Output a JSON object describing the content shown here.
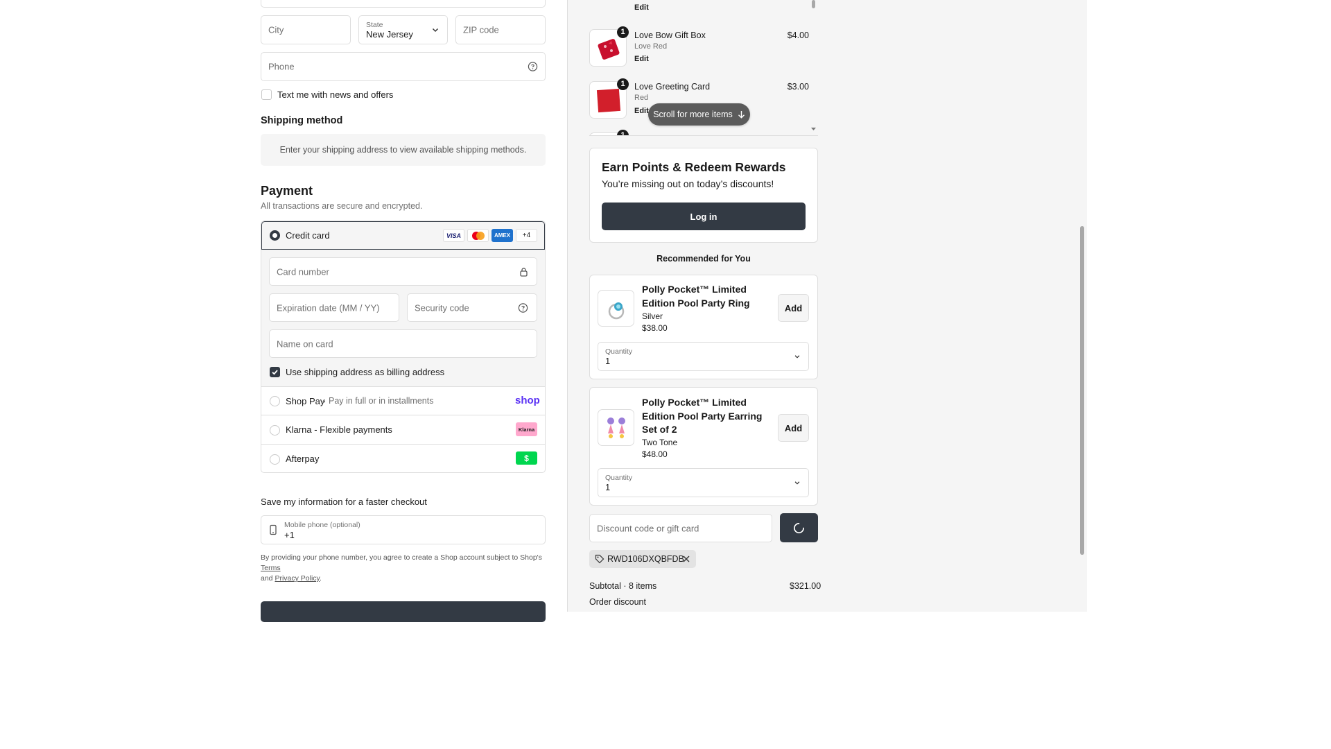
{
  "address": {
    "city_placeholder": "City",
    "state_label": "State",
    "state_value": "New Jersey",
    "zip_placeholder": "ZIP code",
    "phone_placeholder": "Phone",
    "text_offers_label": "Text me with news and offers"
  },
  "shipping": {
    "heading": "Shipping method",
    "notice": "Enter your shipping address to view available shipping methods."
  },
  "payment": {
    "heading": "Payment",
    "subtext": "All transactions are secure and encrypted.",
    "credit_card_label": "Credit card",
    "card_brands": [
      "VISA",
      "Mastercard",
      "AMEX"
    ],
    "more_brands": "+4",
    "card_number_placeholder": "Card number",
    "expiration_placeholder": "Expiration date (MM / YY)",
    "security_placeholder": "Security code",
    "name_placeholder": "Name on card",
    "billing_same_label": "Use shipping address as billing address",
    "shop_pay_label": "Shop Pay",
    "shop_pay_sub": "Pay in full or in installments",
    "shop_pay_logo": "shop",
    "klarna_label": "Klarna - Flexible payments",
    "klarna_logo": "Klarna",
    "afterpay_label": "Afterpay",
    "afterpay_logo": "$"
  },
  "save_info": {
    "heading": "Save my information for a faster checkout",
    "mobile_label": "Mobile phone (optional)",
    "mobile_value": "+1",
    "legal_prefix": "By providing your phone number, you agree to create a Shop account subject to Shop's",
    "terms_link": "Terms",
    "and": "and",
    "privacy_link": "Privacy Policy",
    "period": "."
  },
  "cart": {
    "items": [
      {
        "name": "Love Bow Gift Box",
        "variant": "Love Red",
        "price": "$4.00",
        "qty": "1",
        "edit": "Edit"
      },
      {
        "name": "Love Greeting Card",
        "variant": "Red",
        "price": "$3.00",
        "qty": "1",
        "edit": "Edit"
      }
    ],
    "partial_qty": "1",
    "top_edit": "Edit",
    "scroll_hint": "Scroll for more items"
  },
  "rewards": {
    "title": "Earn Points & Redeem Rewards",
    "subtitle": "You’re missing out on today’s discounts!",
    "login_button": "Log in"
  },
  "recommended": {
    "heading": "Recommended for You",
    "products": [
      {
        "name": "Polly Pocket™ Limited Edition Pool Party Ring",
        "variant": "Silver",
        "price": "$38.00",
        "add": "Add",
        "qty_label": "Quantity",
        "qty_value": "1"
      },
      {
        "name": "Polly Pocket™ Limited Edition Pool Party Earring Set of 2",
        "variant": "Two Tone",
        "price": "$48.00",
        "add": "Add",
        "qty_label": "Quantity",
        "qty_value": "1"
      }
    ]
  },
  "discount": {
    "placeholder": "Discount code or gift card",
    "applied_code": "RWD106DXQBFDB"
  },
  "summary": {
    "subtotal_label": "Subtotal · 8 items",
    "subtotal_value": "$321.00",
    "order_discount_label": "Order discount"
  },
  "colors": {
    "primary": "#333a44",
    "klarna": "#ffa8cd",
    "afterpay": "#00d64f",
    "shop_pay": "#5a31f4"
  }
}
